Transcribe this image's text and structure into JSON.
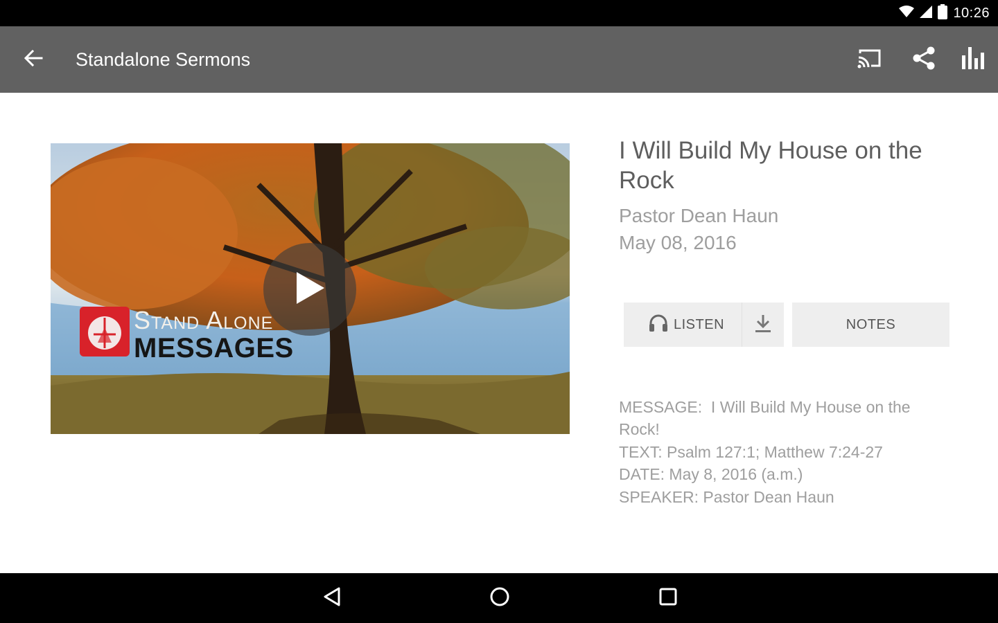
{
  "status_bar": {
    "time": "10:26",
    "icons": [
      "wifi-icon",
      "signal-icon",
      "battery-icon"
    ]
  },
  "toolbar": {
    "title": "Standalone Sermons",
    "back_icon": "arrow-back-icon",
    "actions": [
      "cast-icon",
      "share-icon",
      "equalizer-icon"
    ],
    "background": "#616161"
  },
  "media": {
    "brand_line1": "Stand Alone",
    "brand_line2": "MESSAGES",
    "play_icon": "play-icon",
    "logo_color": "#d8222a"
  },
  "sermon": {
    "title": "I Will Build My House on the Rock",
    "speaker": "Pastor Dean Haun",
    "date": "May 08, 2016"
  },
  "buttons": {
    "listen_label": "LISTEN",
    "notes_label": "NOTES",
    "listen_icon": "headphones-icon",
    "download_icon": "download-icon"
  },
  "description": {
    "line1": "MESSAGE:  I Will Build My House on the Rock!",
    "line2": "TEXT: Psalm 127:1; Matthew 7:24-27",
    "line3": "DATE: May 8, 2016 (a.m.)",
    "line4": "SPEAKER: Pastor Dean Haun"
  },
  "nav_bar": {
    "buttons": [
      "back-triangle-icon",
      "home-circle-icon",
      "recents-square-icon"
    ]
  }
}
